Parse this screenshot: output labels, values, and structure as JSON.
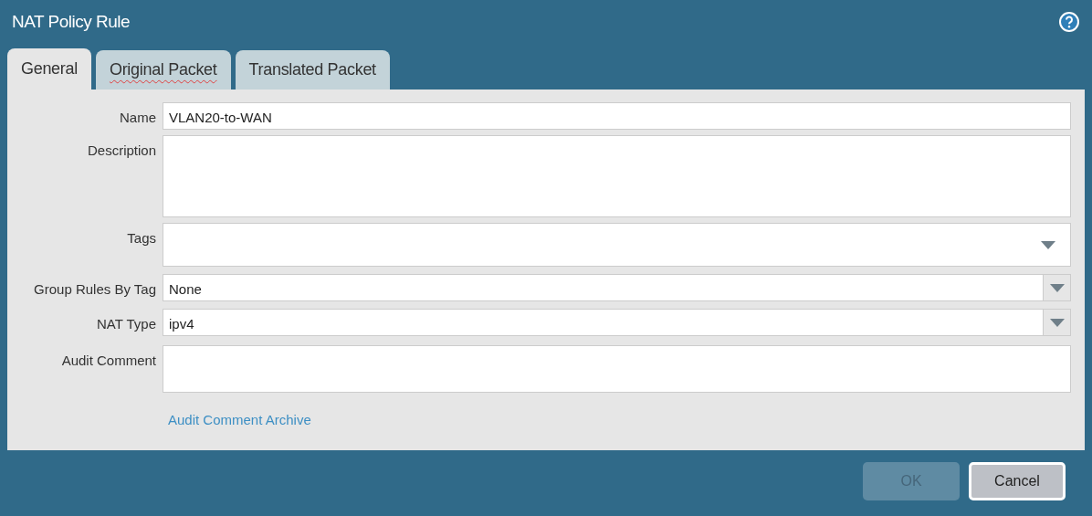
{
  "window": {
    "title": "NAT Policy Rule"
  },
  "tabs": [
    {
      "label": "General",
      "selected": true,
      "misspelled": false
    },
    {
      "label": "Original Packet",
      "selected": false,
      "misspelled": true
    },
    {
      "label": "Translated Packet",
      "selected": false,
      "misspelled": false
    }
  ],
  "fields": [
    {
      "kind": "text",
      "label": "Name",
      "value": "VLAN20-to-WAN"
    },
    {
      "kind": "textarea",
      "label": "Description"
    },
    {
      "kind": "tags",
      "label": "Tags"
    },
    {
      "kind": "select",
      "label": "Group Rules By Tag",
      "value": "None"
    },
    {
      "kind": "select",
      "label": "NAT Type",
      "value": "ipv4"
    },
    {
      "kind": "comment",
      "label": "Audit Comment"
    }
  ],
  "link": "Audit Comment Archive",
  "buttons": [
    {
      "label": "OK",
      "disabled": true,
      "focused": false
    },
    {
      "label": "Cancel",
      "disabled": false,
      "focused": true
    }
  ]
}
